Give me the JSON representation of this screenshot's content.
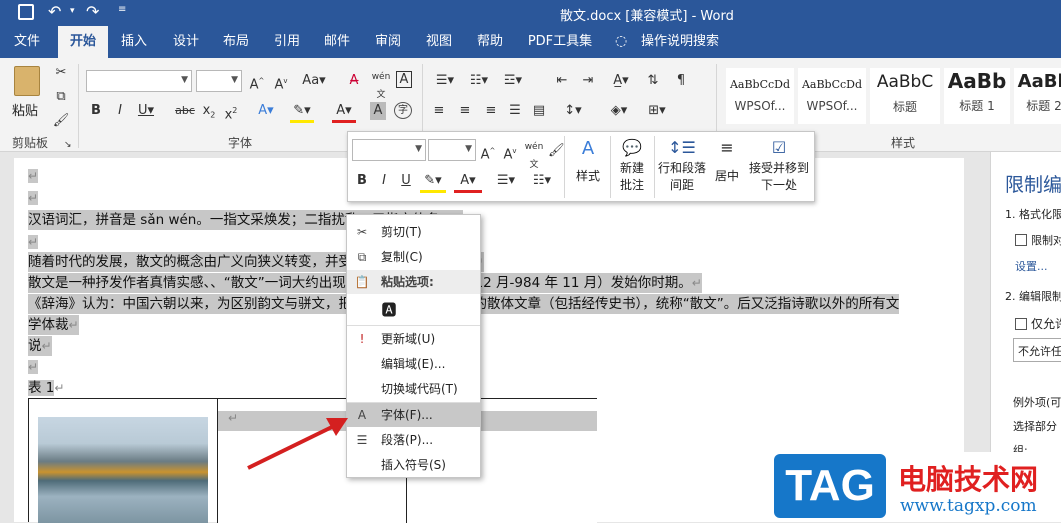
{
  "titlebar": {
    "title": "散文.docx [兼容模式]  -  Word"
  },
  "tabs": [
    "文件",
    "开始",
    "插入",
    "设计",
    "布局",
    "引用",
    "邮件",
    "审阅",
    "视图",
    "帮助",
    "PDF工具集",
    "操作说明搜索"
  ],
  "ribbon": {
    "paste_label": "粘贴",
    "clipboard_label": "剪贴板",
    "font_label": "字体",
    "styles_label": "样式",
    "wen_label": "wén",
    "styles": [
      {
        "sample": "AaBbCcDd",
        "name": "WPSOf..."
      },
      {
        "sample": "AaBbCcDd",
        "name": "WPSOf..."
      },
      {
        "sample": "AaBbC",
        "name": "标题"
      },
      {
        "sample": "AaBb",
        "name": "标题 1"
      },
      {
        "sample": "AaBb",
        "name": "标题 2"
      }
    ]
  },
  "mini_toolbar": {
    "styles_label": "样式",
    "new_comment_label1": "新建",
    "new_comment_label2": "批注",
    "line_spacing_label1": "行和段落",
    "line_spacing_label2": "间距",
    "center_label": "居中",
    "accept_label1": "接受并移到",
    "accept_label2": "下一处",
    "wen_label": "wén"
  },
  "document": {
    "lines": [
      "汉语词汇，拼音是 sǎn wén。一指文采焕发；二指扰乱；三指文体名。",
      "随着时代的发展，散文的概念由广义向狭义转变，并受到西方文化的影响。",
      "散文是一种抒发作者真情实感、、“散文”一词大约出现在北宋年间（976 年 12 月-984 年 11 月）发始你时期。",
      "《辞海》认为：中国六朝以来，为区别韵文与骈文，把凡不押韵、不重排偶的散体文章（包括经传史书），统称“散文”。后又泛指诗歌以外的所有文",
      "学体裁",
      "说"
    ],
    "table_caption": "表  1"
  },
  "context_menu": {
    "items": [
      {
        "label": "剪切(T)",
        "icon": "scissors-icon"
      },
      {
        "label": "复制(C)",
        "icon": "copy-icon"
      },
      {
        "label": "粘贴选项:",
        "icon": "paste-icon"
      },
      {
        "label": "更新域(U)",
        "icon": "update-field-icon"
      },
      {
        "label": "编辑域(E)...",
        "icon": ""
      },
      {
        "label": "切换域代码(T)",
        "icon": ""
      },
      {
        "label": "字体(F)...",
        "icon": "font-icon"
      },
      {
        "label": "段落(P)...",
        "icon": "paragraph-icon"
      },
      {
        "label": "插入符号(S)",
        "icon": ""
      }
    ]
  },
  "right_pane": {
    "title": "限制编",
    "item1": "1. 格式化限",
    "check1": "限制对",
    "settings": "设置...",
    "item2": "2. 编辑限制",
    "check2": "仅允许",
    "select": "不允许任",
    "exceptions": "例外项(可",
    "select_part": "选择部分",
    "group": "组:"
  },
  "watermark": {
    "tag": "TAG",
    "cn": "电脑技术网",
    "url": "www.tagxp.com"
  },
  "colors": {
    "brand": "#2b579a",
    "highlight": "#c7c7c7",
    "arrow": "#d42020",
    "wm_blue": "#1677c9",
    "wm_red": "#e02020"
  }
}
